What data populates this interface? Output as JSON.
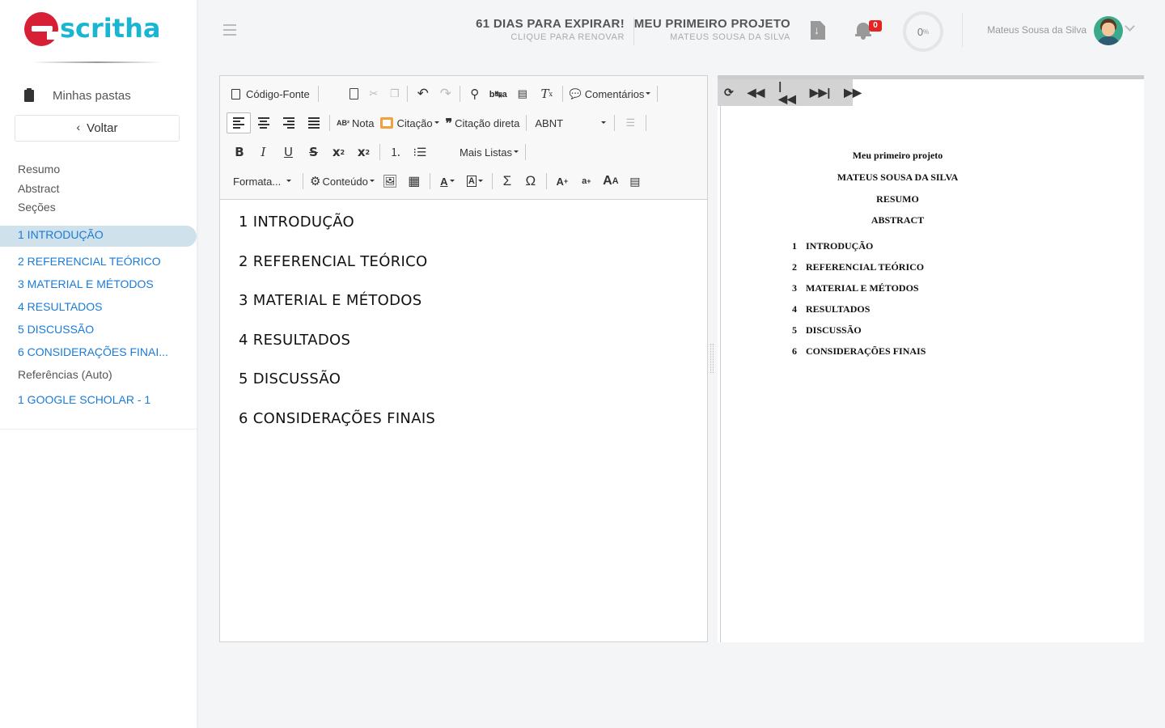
{
  "sidebar": {
    "logo_text": "scritha",
    "folders_label": "Minhas pastas",
    "back_label": "Voltar",
    "links": [
      "Resumo",
      "Abstract",
      "Seções"
    ],
    "active_section": "1 INTRODUÇÃO",
    "sections": [
      "2 REFERENCIAL TEÓRICO",
      "3 MATERIAL E MÉTODOS",
      "4 RESULTADOS",
      "5 DISCUSSÃO",
      "6 CONSIDERAÇÕES FINAI..."
    ],
    "references_label": "Referências (Auto)",
    "reference_item": "1 GOOGLE SCHOLAR - 1"
  },
  "header": {
    "expire_title": "61 DIAS PARA EXPIRAR!",
    "expire_sub": "CLIQUE PARA RENOVAR",
    "project_title": "MEU PRIMEIRO PROJETO",
    "project_sub": "MATEUS SOUSA DA SILVA",
    "notifications_count": "0",
    "progress_value": "0",
    "progress_unit": "%",
    "user_name": "Mateus Sousa da Silva"
  },
  "toolbar": {
    "source_label": "Código-Fonte",
    "comments_label": "Comentários",
    "nota_label": "Nota",
    "citacao_label": "Citação",
    "citacao_direta_label": "Citação direta",
    "abnt_label": "ABNT",
    "mais_listas_label": "Mais Listas",
    "formata_label": "Formata...",
    "conteudo_label": "Conteúdo"
  },
  "document": {
    "headings": [
      "1 INTRODUÇÃO",
      "2 REFERENCIAL TEÓRICO",
      "3 MATERIAL E MÉTODOS",
      "4 RESULTADOS",
      "5 DISCUSSÃO",
      "6 CONSIDERAÇÕES FINAIS"
    ]
  },
  "preview": {
    "title": "Meu primeiro projeto",
    "author": "MATEUS SOUSA DA SILVA",
    "resumo": "RESUMO",
    "abstract": "ABSTRACT",
    "toc": [
      {
        "n": "1",
        "t": "INTRODUÇÃO"
      },
      {
        "n": "2",
        "t": "REFERENCIAL TEÓRICO"
      },
      {
        "n": "3",
        "t": "MATERIAL E MÉTODOS"
      },
      {
        "n": "4",
        "t": "RESULTADOS"
      },
      {
        "n": "5",
        "t": "DISCUSSÃO"
      },
      {
        "n": "6",
        "t": "CONSIDERAÇÕES FINAIS"
      }
    ]
  }
}
